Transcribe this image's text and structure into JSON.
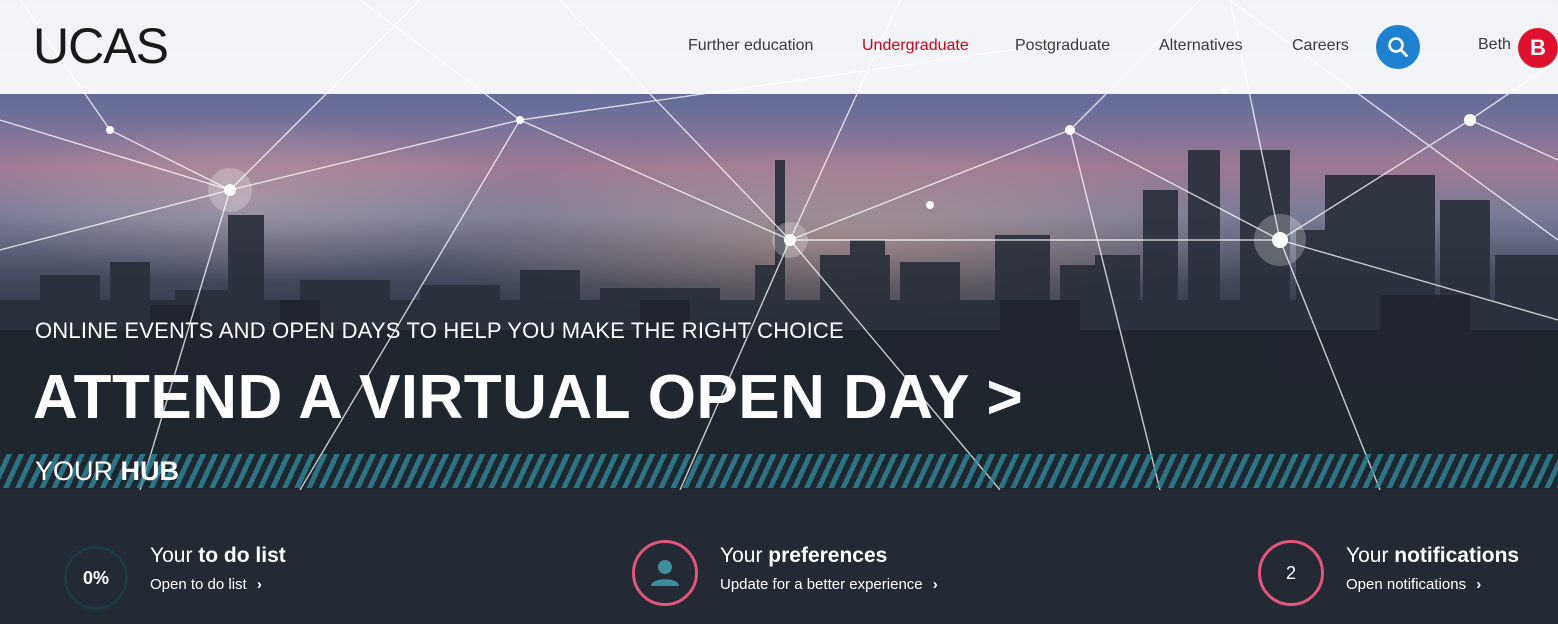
{
  "header": {
    "logo": "UCAS",
    "nav": [
      "Further education",
      "Undergraduate",
      "Postgraduate",
      "Alternatives",
      "Careers"
    ],
    "active_nav": "Undergraduate",
    "search_icon": "search-icon",
    "user_name": "Beth",
    "avatar_initial": "B"
  },
  "hero": {
    "subtitle": "ONLINE EVENTS AND OPEN DAYS TO HELP YOU MAKE THE RIGHT CHOICE",
    "title": "ATTEND A VIRTUAL OPEN DAY >"
  },
  "hub": {
    "label_prefix": "YOUR",
    "label_bold": "HUB",
    "items": [
      {
        "circle_text": "0%",
        "title_prefix": "Your",
        "title_bold": "to do list",
        "link": "Open to do list",
        "icon": ""
      },
      {
        "circle_text": "",
        "title_prefix": "Your",
        "title_bold": "preferences",
        "link": "Update for a better experience",
        "icon": "person-icon"
      },
      {
        "circle_text": "2",
        "title_prefix": "Your",
        "title_bold": "notifications",
        "link": "Open notifications",
        "icon": ""
      }
    ]
  },
  "colors": {
    "brand_red": "#d0021b",
    "search_blue": "#1f82d0",
    "avatar_red": "#e0112b",
    "hub_bg": "#232a33",
    "accent_teal": "#2e8fa0",
    "accent_pink": "#e0567a",
    "progress_ring": "#1e3a44"
  }
}
